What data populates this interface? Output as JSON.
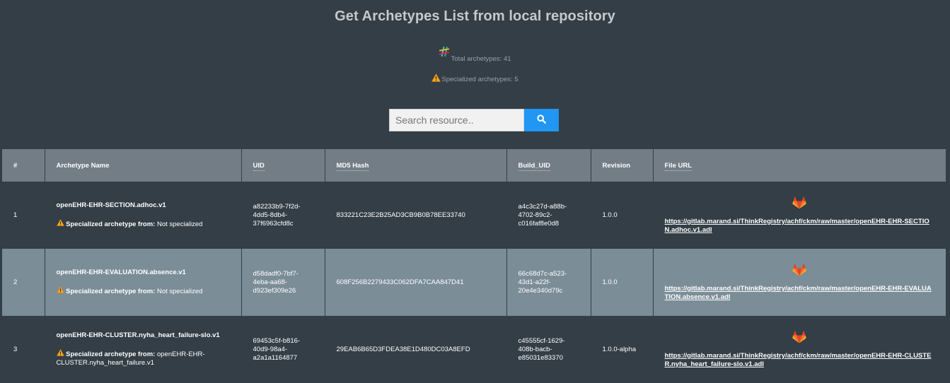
{
  "page": {
    "title": "Get Archetypes List from local repository"
  },
  "stats": {
    "total_label": "Total archetypes: 41",
    "specialized_label": "Specialized archetypes: 5",
    "total_icon": "hash-icon",
    "specialized_icon": "warning-icon"
  },
  "search": {
    "placeholder": "Search resource..",
    "button_icon": "search-icon",
    "button_color": "#2196f3"
  },
  "table": {
    "headers": [
      "#",
      "Archetype Name",
      "UID",
      "MD5 Hash",
      "Build_UID",
      "Revision",
      "File URL"
    ],
    "spec_label": "Specialized archetype from:",
    "rows": [
      {
        "num": "1",
        "name": "openEHR-EHR-SECTION.adhoc.v1",
        "spec_from": "Not specialized",
        "uid": "a82233b9-7f2d-4dd5-8db4-37f6963cfd8c",
        "md5": "833221C23E2B25AD3CB9B0B78EE33740",
        "build_uid": "a4c3c27d-a88b-4702-89c2-c016faf8e0d8",
        "revision": "1.0.0",
        "file_url": "https://gitlab.marand.si/ThinkRegistry/achf/ckm/raw/master/openEHR-EHR-SECTION.adhoc.v1.adl"
      },
      {
        "num": "2",
        "name": "openEHR-EHR-EVALUATION.absence.v1",
        "spec_from": "Not specialized",
        "uid": "d58dadf0-7bf7-4eba-aa68-d923ef309e26",
        "md5": "608F256B2279433C062DFA7CAA847D41",
        "build_uid": "66c68d7c-a523-43d1-a22f-20e4e340d79c",
        "revision": "1.0.0",
        "file_url": "https://gitlab.marand.si/ThinkRegistry/achf/ckm/raw/master/openEHR-EHR-EVALUATION.absence.v1.adl"
      },
      {
        "num": "3",
        "name": "openEHR-EHR-CLUSTER.nyha_heart_failure-slo.v1",
        "spec_from": "openEHR-EHR-CLUSTER.nyha_heart_failure.v1",
        "uid": "69453c5f-b816-40d9-98a4-a2a1a1164877",
        "md5": "29EAB6B65D3FDEA38E1D480DC03A8EFD",
        "build_uid": "c45555cf-1629-408b-bacb-e85031e83370",
        "revision": "1.0.0-alpha",
        "file_url": "https://gitlab.marand.si/ThinkRegistry/achf/ckm/raw/master/openEHR-EHR-CLUSTER.nyha_heart_failure-slo.v1.adl"
      }
    ],
    "row_icons": {
      "spec": "warning-icon",
      "file": "gitlab-icon"
    }
  },
  "colors": {
    "background": "#333e46",
    "header_bg": "#737d86",
    "alt_row_bg": "#7b8d97",
    "warning": "#f5a623",
    "gitlab": "#e24329"
  }
}
